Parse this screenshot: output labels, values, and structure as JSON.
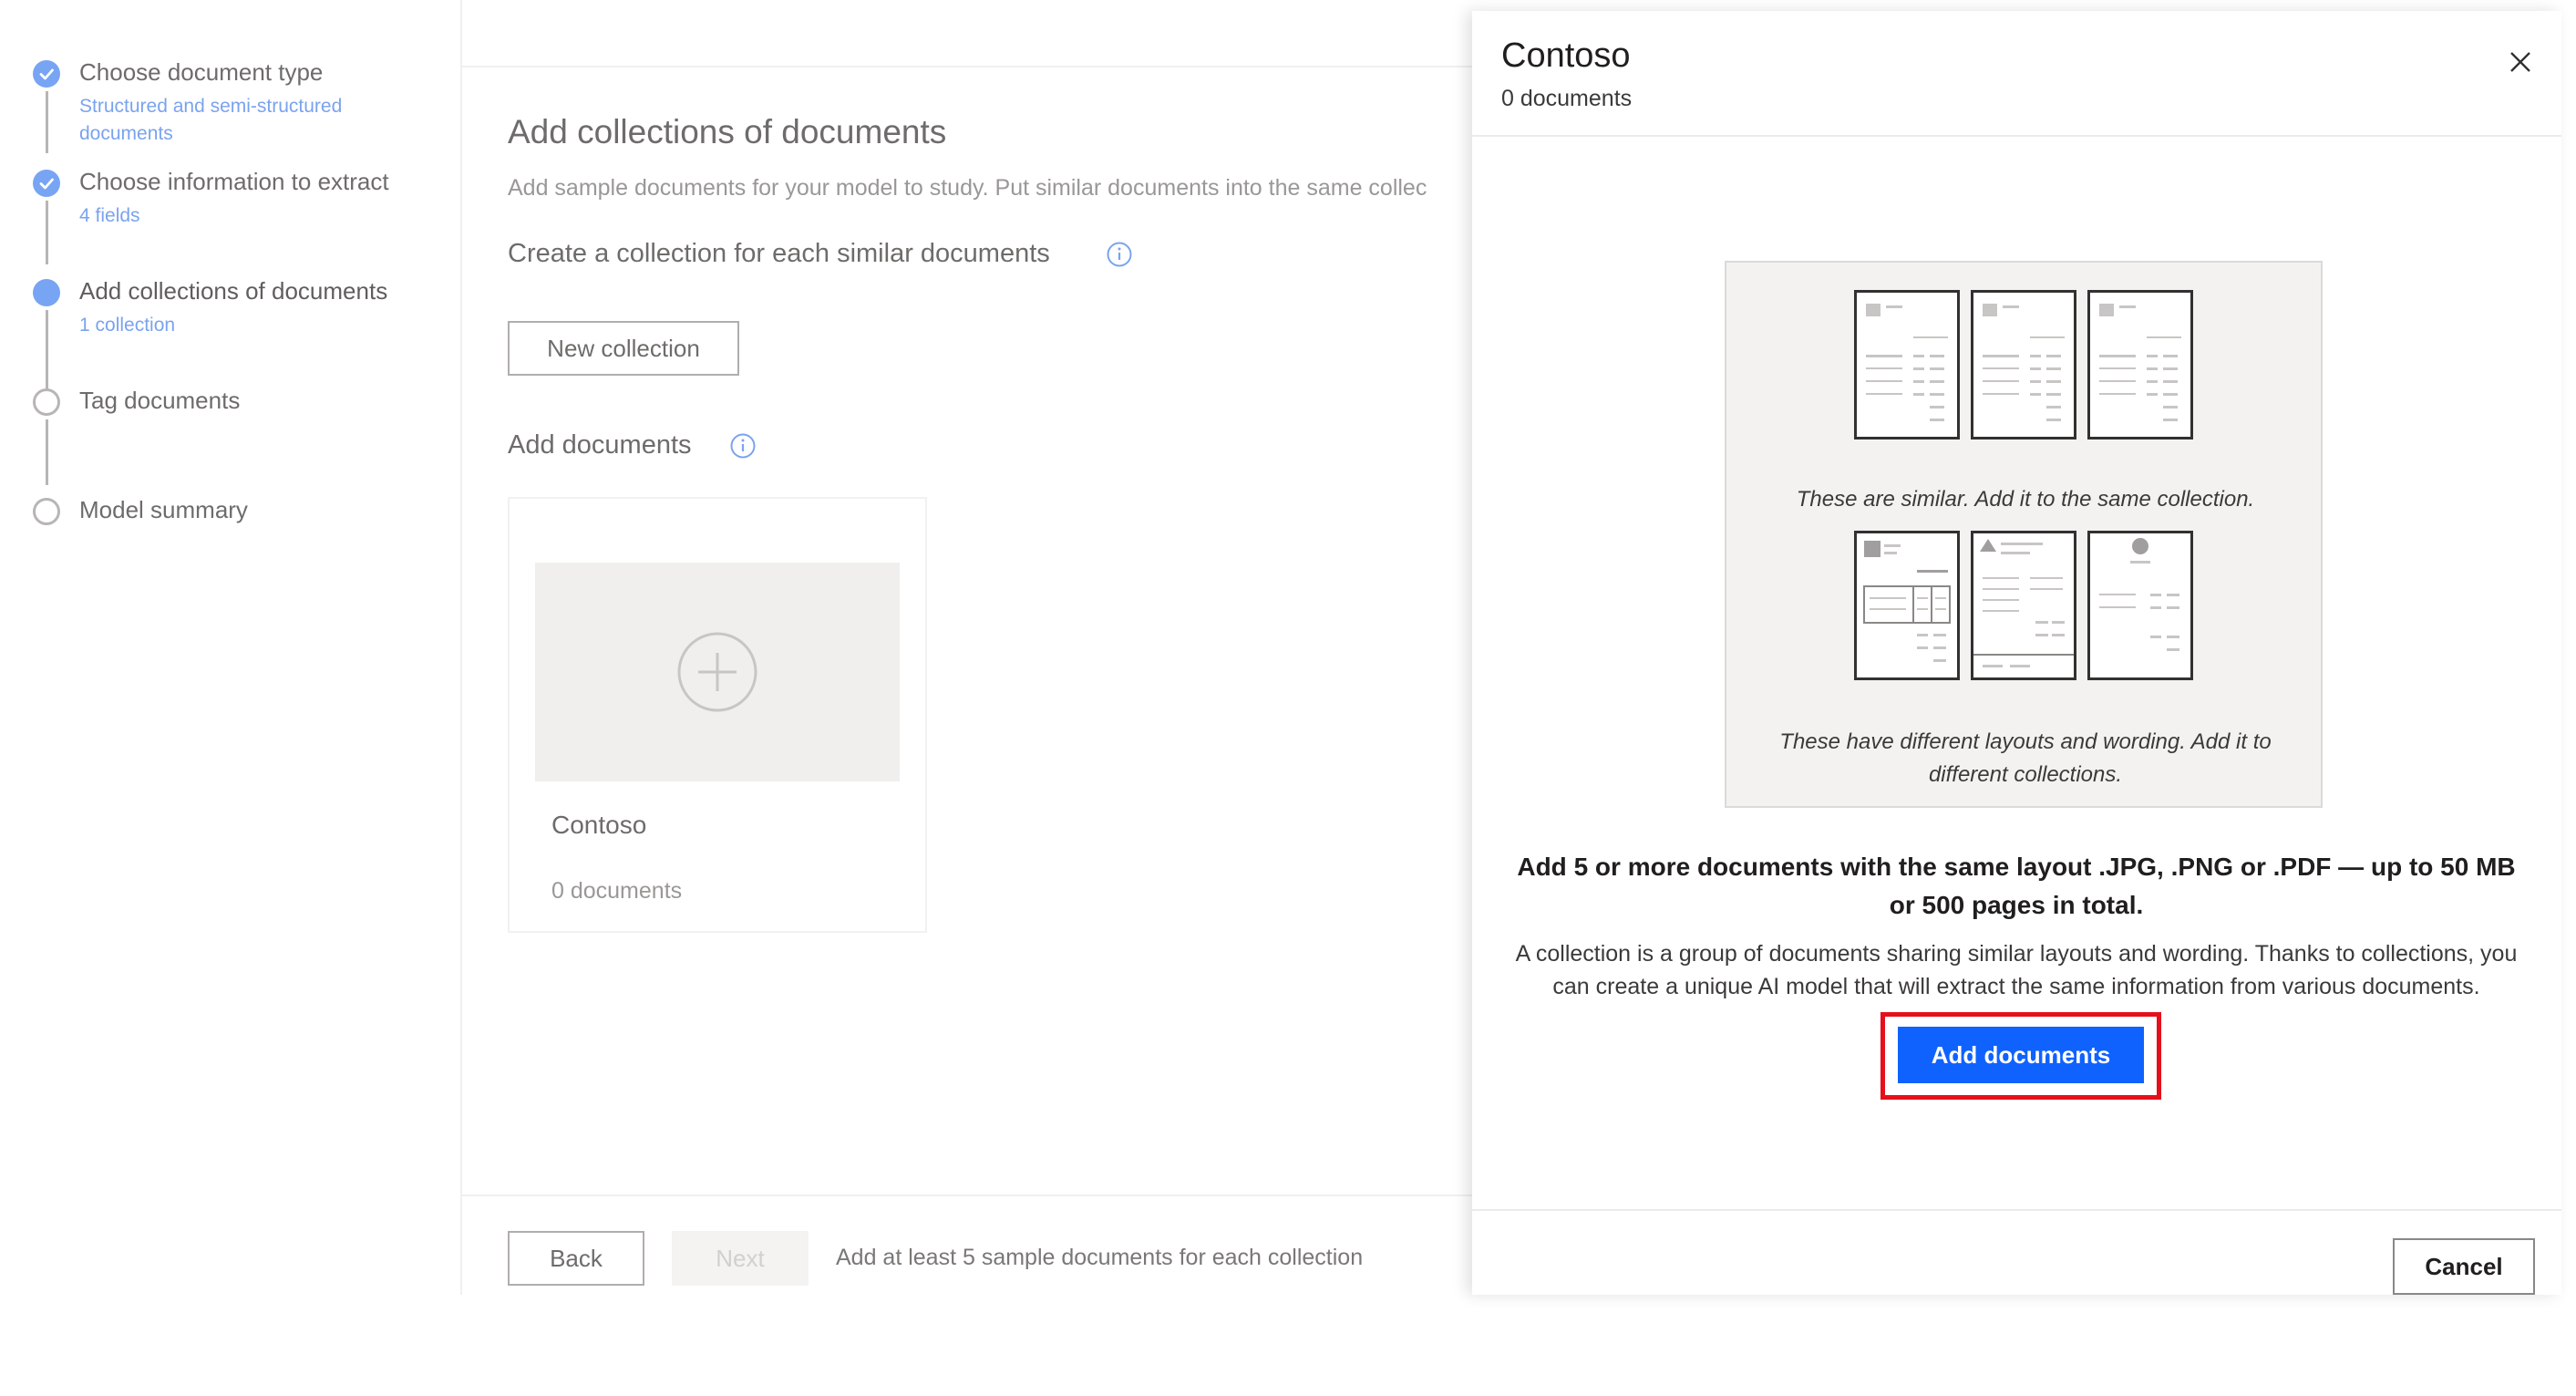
{
  "stepper": {
    "steps": [
      {
        "title": "Choose document type",
        "subtitle": "Structured and semi-structured documents",
        "state": "done"
      },
      {
        "title": "Choose information to extract",
        "subtitle": "4 fields",
        "state": "done"
      },
      {
        "title": "Add collections of documents",
        "subtitle": "1 collection",
        "state": "current"
      },
      {
        "title": "Tag documents",
        "subtitle": "",
        "state": "todo"
      },
      {
        "title": "Model summary",
        "subtitle": "",
        "state": "todo"
      }
    ]
  },
  "main": {
    "heading": "Add collections of documents",
    "description": "Add sample documents for your model to study. Put similar documents into the same collec",
    "create_heading": "Create a collection for each similar documents",
    "new_collection_label": "New collection",
    "add_documents_heading": "Add documents",
    "collection_card": {
      "name": "Contoso",
      "count": "0 documents"
    },
    "footer": {
      "back_label": "Back",
      "next_label": "Next",
      "note": "Add at least 5 sample documents for each collection"
    }
  },
  "panel": {
    "title": "Contoso",
    "subtitle": "0 documents",
    "illustration": {
      "caption_similar": "These are similar. Add it to the same collection.",
      "caption_different": "These have different layouts and wording. Add it to different collections."
    },
    "bold_text": "Add 5 or more documents with the same layout .JPG, .PNG or .PDF — up to 50 MB or 500 pages in total.",
    "body_text": "A collection is a group of documents sharing similar layouts and wording. Thanks to collections, you can create a unique AI model that will extract the same information from various documents.",
    "add_documents_label": "Add documents",
    "cancel_label": "Cancel"
  },
  "colors": {
    "accent": "#0f62fe",
    "step_done": "#78a4f4",
    "highlight": "#e5101b"
  }
}
